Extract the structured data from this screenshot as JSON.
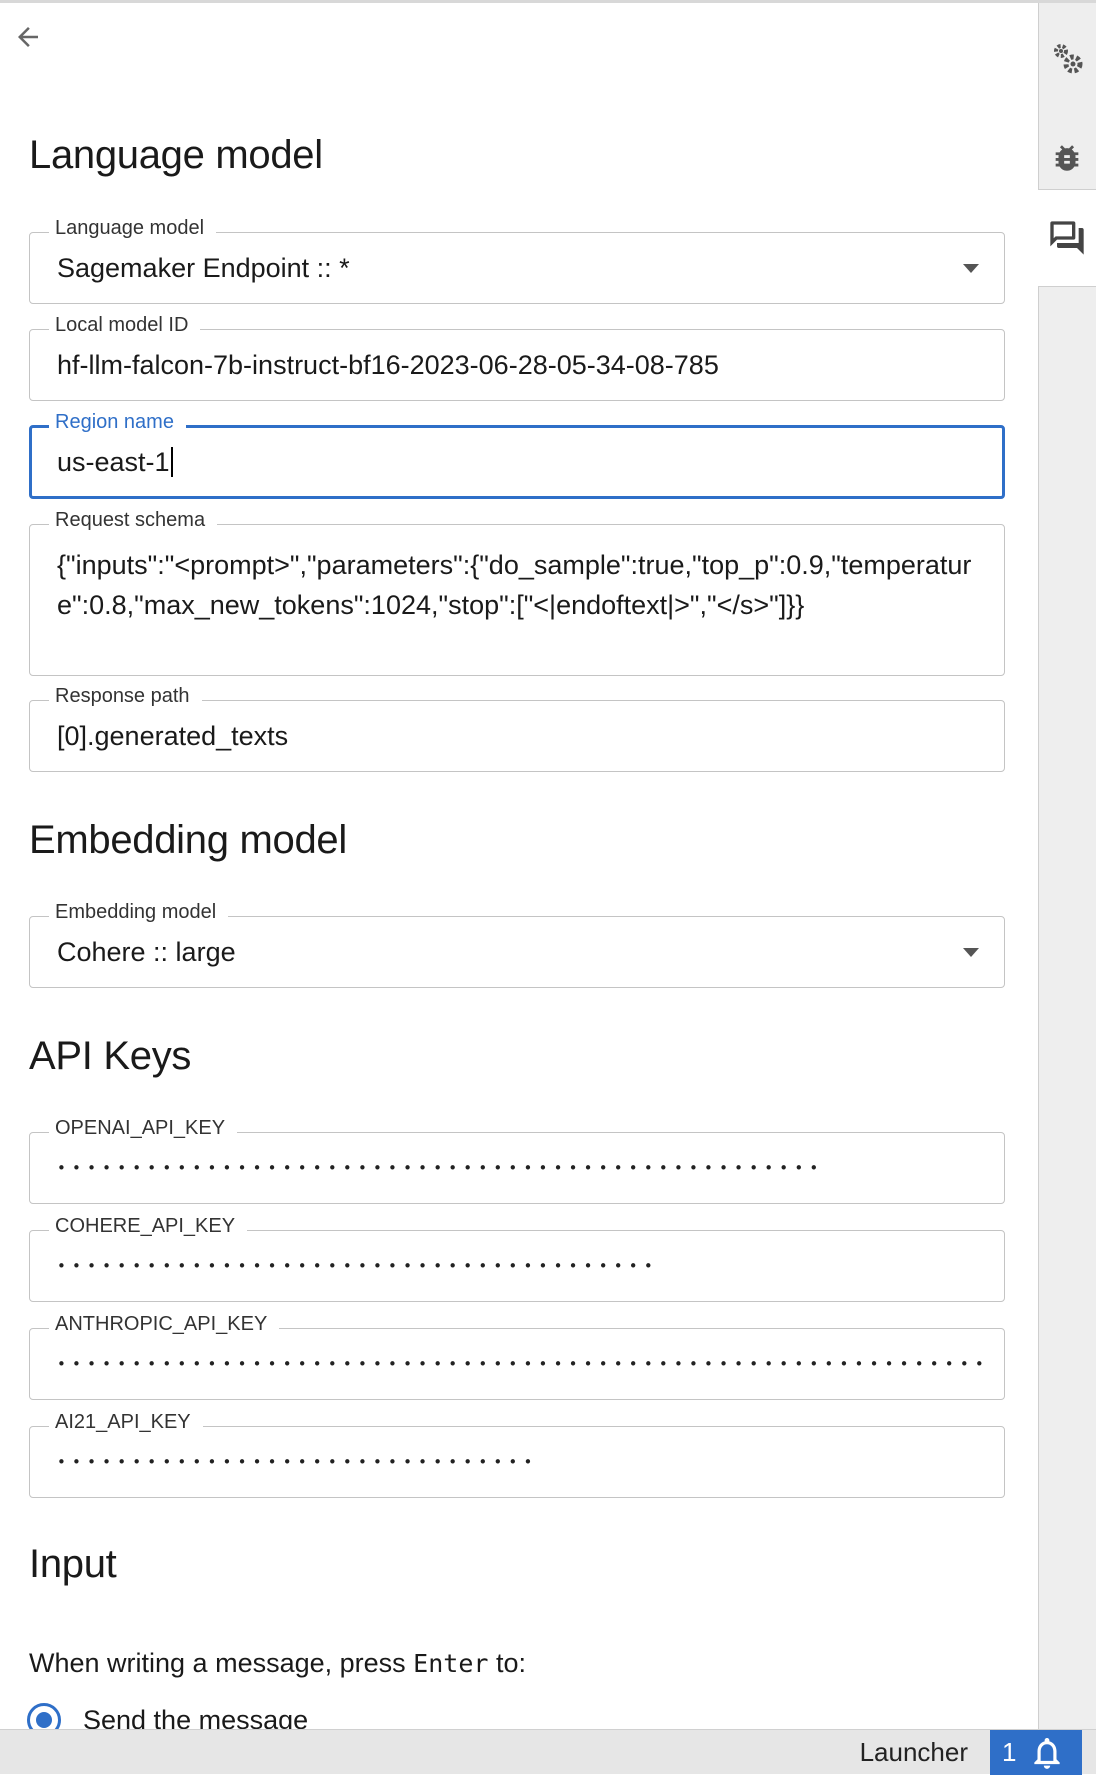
{
  "header": {
    "back_icon": "arrow-left-icon"
  },
  "sections": {
    "language_model": {
      "heading": "Language model",
      "model_select": {
        "label": "Language model",
        "value": "Sagemaker Endpoint :: *"
      },
      "local_model_id": {
        "label": "Local model ID",
        "value": "hf-llm-falcon-7b-instruct-bf16-2023-06-28-05-34-08-785"
      },
      "region_name": {
        "label": "Region name",
        "value": "us-east-1"
      },
      "request_schema": {
        "label": "Request schema",
        "value": "{\"inputs\":\"<prompt>\",\"parameters\":{\"do_sample\":true,\"top_p\":0.9,\"temperature\":0.8,\"max_new_tokens\":1024,\"stop\":[\"<|endoftext|>\",\"</s>\"]}}"
      },
      "response_path": {
        "label": "Response path",
        "value": "[0].generated_texts"
      }
    },
    "embedding_model": {
      "heading": "Embedding model",
      "model_select": {
        "label": "Embedding model",
        "value": "Cohere :: large"
      }
    },
    "api_keys": {
      "heading": "API Keys",
      "keys": [
        {
          "label": "OPENAI_API_KEY",
          "masked": "•••••••••••••••••••••••••••••••••••••••••••••••••••"
        },
        {
          "label": "COHERE_API_KEY",
          "masked": "••••••••••••••••••••••••••••••••••••••••"
        },
        {
          "label": "ANTHROPIC_API_KEY",
          "masked": "••••••••••••••••••••••••••••••••••••••••••••••••••••••••••••••••••••••••••••••••••"
        },
        {
          "label": "AI21_API_KEY",
          "masked": "••••••••••••••••••••••••••••••••"
        }
      ]
    },
    "input": {
      "heading": "Input",
      "description_prefix": "When writing a message, press ",
      "description_key": "Enter",
      "description_suffix": " to:",
      "option_selected": "Send the message"
    }
  },
  "right_sidebar": {
    "tabs": [
      {
        "name": "settings",
        "icon": "gears-icon"
      },
      {
        "name": "debugger",
        "icon": "bug-icon"
      },
      {
        "name": "chat",
        "icon": "chat-icon",
        "active": true
      }
    ]
  },
  "status_bar": {
    "launcher_label": "Launcher",
    "notification_count": "1",
    "notification_icon": "bell-icon"
  },
  "colors": {
    "accent": "#2f6fc8",
    "border": "#c4c4c4",
    "sidebar_bg": "#eeeeee"
  }
}
